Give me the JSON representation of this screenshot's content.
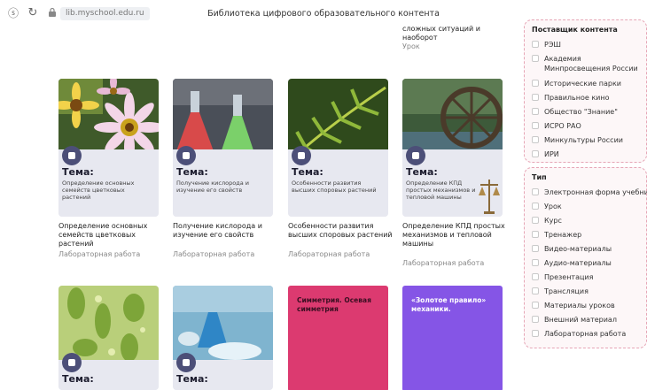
{
  "browser": {
    "url": "lib.myschool.edu.ru",
    "page_title": "Библиотека цифрового образовательного контента"
  },
  "top_partial": {
    "title": "сложных ситуаций и наоборот",
    "type": "Урок"
  },
  "cards": [
    {
      "tema": "Тема:",
      "panel_desc": "Определение основных семейств цветковых растений",
      "title": "Определение основных семейств цветковых растений",
      "type": "Лабораторная работа"
    },
    {
      "tema": "Тема:",
      "panel_desc": "Получение кислорода и изучение его свойств",
      "title": "Получение кислорода и изучение его свойств",
      "type": "Лабораторная работа"
    },
    {
      "tema": "Тема:",
      "panel_desc": "Особенности развития высших споровых растений",
      "title": "Особенности развития высших споровых растений",
      "type": "Лабораторная работа"
    },
    {
      "tema": "Тема:",
      "panel_desc": "Определение КПД простых механизмов и тепловой машины",
      "title": "Определение КПД простых механизмов и тепловой машины",
      "type": "Лабораторная работа"
    }
  ],
  "bottom_cards": [
    {
      "tema": "Тема:"
    },
    {
      "tema": "Тема:"
    },
    {
      "title": "Симметрия. Осевая симметрия",
      "bg": "#dc3a70",
      "text_color": "#3a0f22"
    },
    {
      "title": "«Золотое правило» механики.",
      "bg": "#8555e6",
      "text_color": "#ffffff"
    }
  ],
  "filters": {
    "provider": {
      "title": "Поставщик контента",
      "items": [
        "РЭШ",
        "Академия Минпросвещения России",
        "Исторические парки",
        "Правильное кино",
        "Общество \"Знание\"",
        "ИСРО РАО",
        "Минкультуры России",
        "ИРИ"
      ]
    },
    "type": {
      "title": "Тип",
      "items": [
        "Электронная форма учебника",
        "Урок",
        "Курс",
        "Тренажер",
        "Видео-материалы",
        "Аудио-материалы",
        "Презентация",
        "Трансляция",
        "Материалы уроков",
        "Внешний материал",
        "Лабораторная работа"
      ]
    }
  },
  "colors": {
    "badge": "#4c4f78",
    "panel": "#e7e8f0",
    "filter_border": "#e6a6b6"
  }
}
